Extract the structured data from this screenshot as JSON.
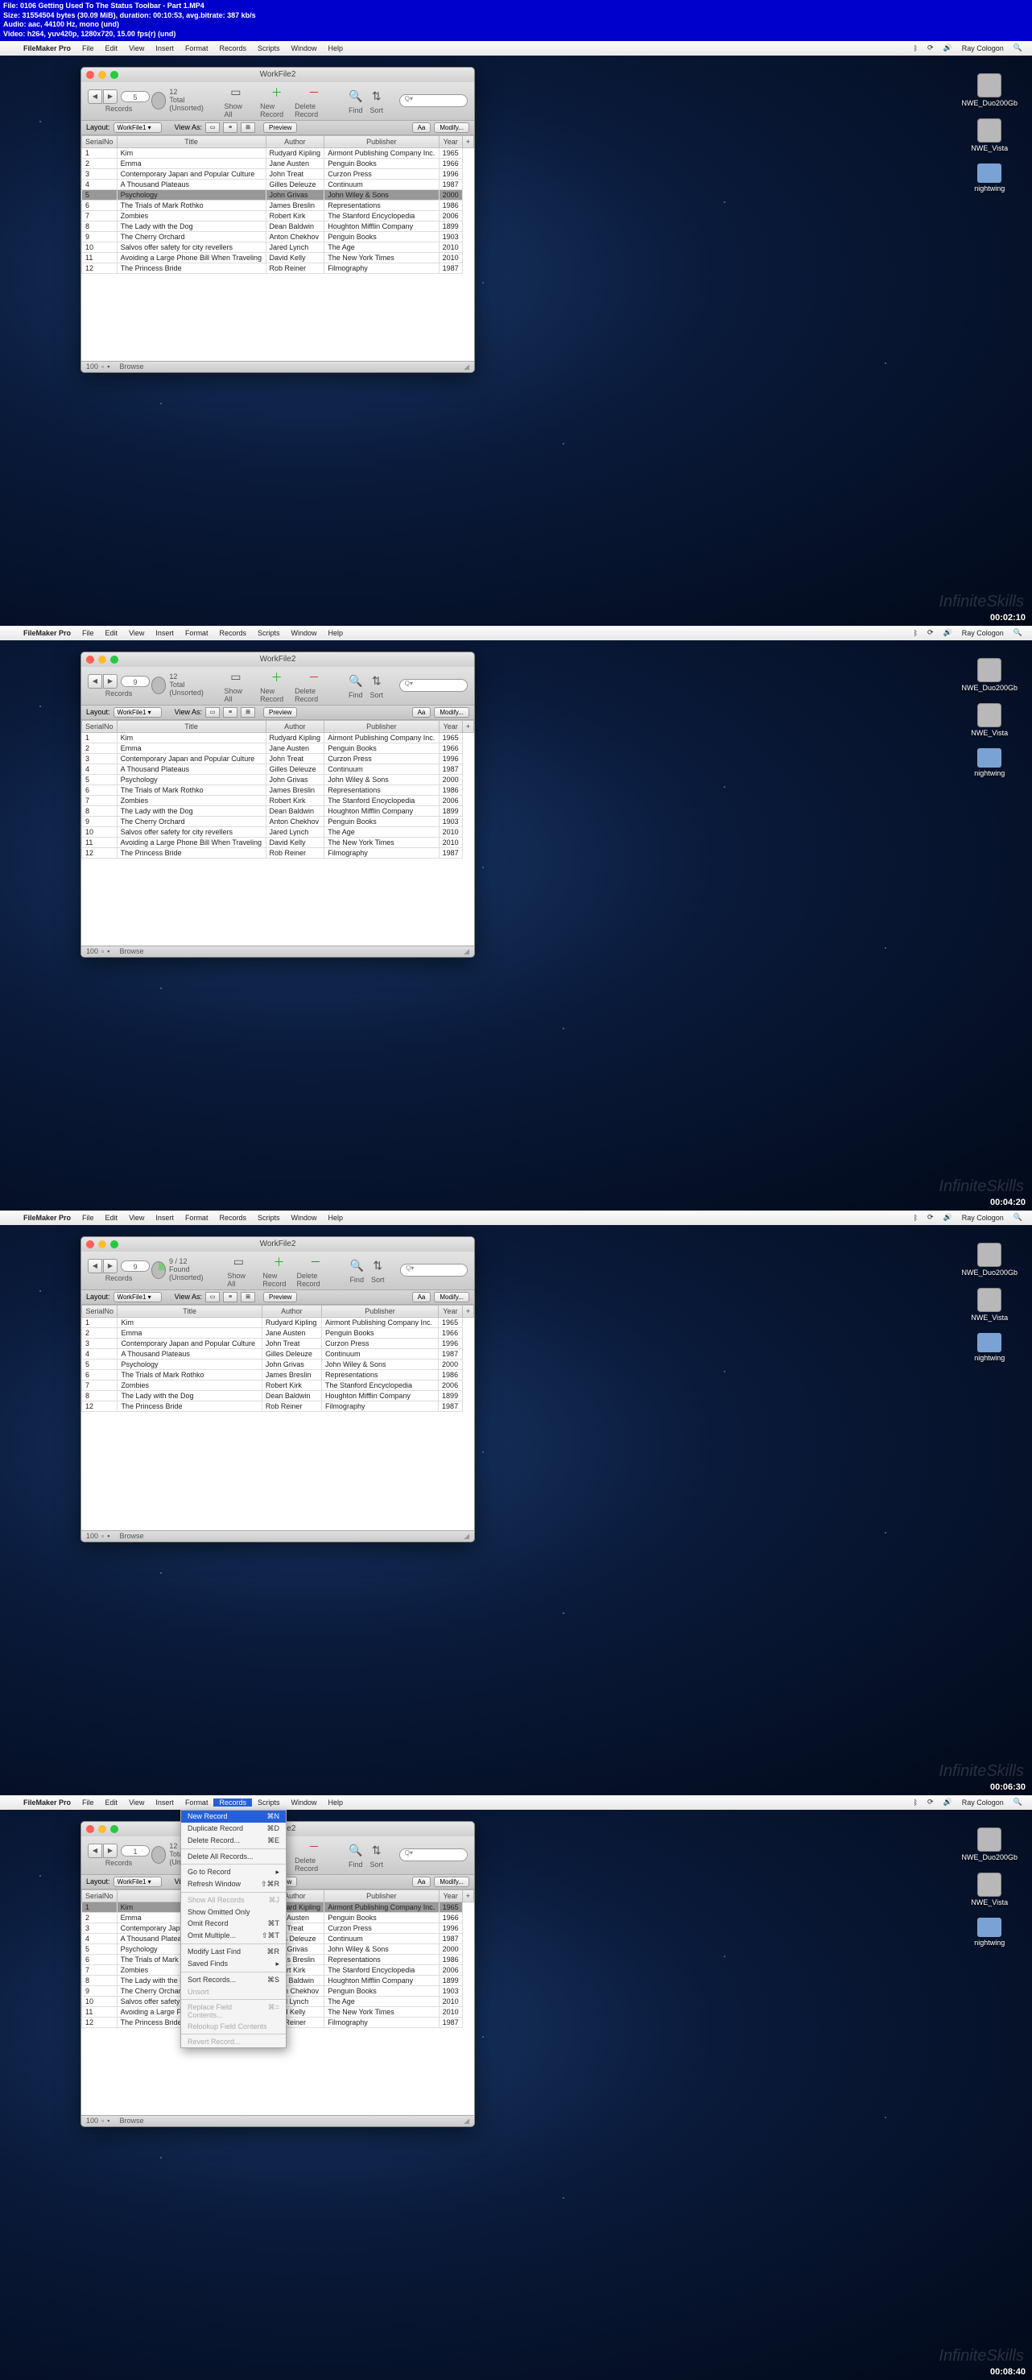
{
  "header_lines": [
    "File: 0106 Getting Used To The Status Toolbar - Part 1.MP4",
    "Size: 31554504 bytes (30.09 MiB), duration: 00:10:53, avg.bitrate: 387 kb/s",
    "Audio: aac, 44100 Hz, mono (und)",
    "Video: h264, yuv420p, 1280x720, 15.00 fps(r) (und)"
  ],
  "menu": {
    "apple": "",
    "app": "FileMaker Pro",
    "items": [
      "File",
      "Edit",
      "View",
      "Insert",
      "Format",
      "Records",
      "Scripts",
      "Window",
      "Help"
    ],
    "user": "Ray Cologon"
  },
  "win_title": "WorkFile2",
  "layout": {
    "label": "Layout:",
    "value": "WorkFile1",
    "view": "View As:",
    "preview": "Preview",
    "aa": "Aa",
    "modify": "Modify..."
  },
  "toolbar": {
    "records": "Records",
    "total_un": "Total (Unsorted)",
    "found_un": "Found (Unsorted)",
    "show_all": "Show All",
    "new_rec": "New Record",
    "del_rec": "Delete Record",
    "find": "Find",
    "sort": "Sort",
    "search": "Q▾"
  },
  "status": {
    "zoom": "100",
    "mode": "Browse"
  },
  "desktop": [
    "NWE_Duo200Gb",
    "NWE_Vista",
    "nightwing"
  ],
  "watermark": "InfiniteSkills",
  "cols": [
    "SerialNo",
    "Title",
    "Author",
    "Publisher",
    "Year"
  ],
  "frames": [
    {
      "timestamp": "00:02:10",
      "counter": "5",
      "total": "12",
      "rec_label": "12",
      "rows": [
        [
          "1",
          "Kim",
          "Rudyard Kipling",
          "Airmont Publishing Company Inc.",
          "1965"
        ],
        [
          "2",
          "Emma",
          "Jane Austen",
          "Penguin Books",
          "1966"
        ],
        [
          "3",
          "Contemporary Japan and Popular Culture",
          "John Treat",
          "Curzon Press",
          "1996"
        ],
        [
          "4",
          "A Thousand Plateaus",
          "Gilles Deleuze",
          "Continuum",
          "1987"
        ],
        [
          "5",
          "Psychology",
          "John Grivas",
          "John Wiley & Sons",
          "2000"
        ],
        [
          "6",
          "The Trials of Mark Rothko",
          "James Breslin",
          "Representations",
          "1986"
        ],
        [
          "7",
          "Zombies",
          "Robert Kirk",
          "The Stanford Encyclopedia",
          "2006"
        ],
        [
          "8",
          "The Lady with the Dog",
          "Dean Baldwin",
          "Houghton Mifflin Company",
          "1899"
        ],
        [
          "9",
          "The Cherry Orchard",
          "Anton Chekhov",
          "Penguin Books",
          "1903"
        ],
        [
          "10",
          "Salvos offer safety for city revellers",
          "Jared Lynch",
          "The Age",
          "2010"
        ],
        [
          "11",
          "Avoiding a Large Phone Bill When Traveling",
          "David Kelly",
          "The New York Times",
          "2010"
        ],
        [
          "12",
          "The Princess Bride",
          "Rob Reiner",
          "Filmography",
          "1987"
        ]
      ],
      "hl": 4
    },
    {
      "timestamp": "00:04:20",
      "counter": "9",
      "total": "12",
      "rec_label": "12",
      "rows": [
        [
          "1",
          "Kim",
          "Rudyard Kipling",
          "Airmont Publishing Company Inc.",
          "1965"
        ],
        [
          "2",
          "Emma",
          "Jane Austen",
          "Penguin Books",
          "1966"
        ],
        [
          "3",
          "Contemporary Japan and Popular Culture",
          "John Treat",
          "Curzon Press",
          "1996"
        ],
        [
          "4",
          "A Thousand Plateaus",
          "Gilles Deleuze",
          "Continuum",
          "1987"
        ],
        [
          "5",
          "Psychology",
          "John Grivas",
          "John Wiley & Sons",
          "2000"
        ],
        [
          "6",
          "The Trials of Mark Rothko",
          "James Breslin",
          "Representations",
          "1986"
        ],
        [
          "7",
          "Zombies",
          "Robert Kirk",
          "The Stanford Encyclopedia",
          "2006"
        ],
        [
          "8",
          "The Lady with the Dog",
          "Dean Baldwin",
          "Houghton Mifflin Company",
          "1899"
        ],
        [
          "9",
          "The Cherry Orchard",
          "Anton Chekhov",
          "Penguin Books",
          "1903"
        ],
        [
          "10",
          "Salvos offer safety for city revellers",
          "Jared Lynch",
          "The Age",
          "2010"
        ],
        [
          "11",
          "Avoiding a Large Phone Bill When Traveling",
          "David Kelly",
          "The New York Times",
          "2010"
        ],
        [
          "12",
          "The Princess Bride",
          "Rob Reiner",
          "Filmography",
          "1987"
        ]
      ],
      "hl": -1
    },
    {
      "timestamp": "00:06:30",
      "counter": "9",
      "total": "9 / 12",
      "rec_label": "9 / 12",
      "found": true,
      "rows": [
        [
          "1",
          "Kim",
          "Rudyard Kipling",
          "Airmont Publishing Company Inc.",
          "1965"
        ],
        [
          "2",
          "Emma",
          "Jane Austen",
          "Penguin Books",
          "1966"
        ],
        [
          "3",
          "Contemporary Japan and Popular Culture",
          "John Treat",
          "Curzon Press",
          "1996"
        ],
        [
          "4",
          "A Thousand Plateaus",
          "Gilles Deleuze",
          "Continuum",
          "1987"
        ],
        [
          "5",
          "Psychology",
          "John Grivas",
          "John Wiley & Sons",
          "2000"
        ],
        [
          "6",
          "The Trials of Mark Rothko",
          "James Breslin",
          "Representations",
          "1986"
        ],
        [
          "7",
          "Zombies",
          "Robert Kirk",
          "The Stanford Encyclopedia",
          "2006"
        ],
        [
          "8",
          "The Lady with the Dog",
          "Dean Baldwin",
          "Houghton Mifflin Company",
          "1899"
        ],
        [
          "12",
          "The Princess Bride",
          "Rob Reiner",
          "Filmography",
          "1987"
        ]
      ],
      "hl": -1
    },
    {
      "timestamp": "00:08:40",
      "counter": "1",
      "total": "12",
      "rec_label": "12",
      "menu_open": true,
      "rows": [
        [
          "1",
          "Kim",
          "Rudyard Kipling",
          "Airmont Publishing Company Inc.",
          "1965"
        ],
        [
          "2",
          "Emma",
          "Jane Austen",
          "Penguin Books",
          "1966"
        ],
        [
          "3",
          "Contemporary Japan and Popular Culture",
          "John Treat",
          "Curzon Press",
          "1996"
        ],
        [
          "4",
          "A Thousand Plateaus",
          "Gilles Deleuze",
          "Continuum",
          "1987"
        ],
        [
          "5",
          "Psychology",
          "John Grivas",
          "John Wiley & Sons",
          "2000"
        ],
        [
          "6",
          "The Trials of Mark Rothko",
          "James Breslin",
          "Representations",
          "1986"
        ],
        [
          "7",
          "Zombies",
          "Robert Kirk",
          "The Stanford Encyclopedia",
          "2006"
        ],
        [
          "8",
          "The Lady with the Dog",
          "Dean Baldwin",
          "Houghton Mifflin Company",
          "1899"
        ],
        [
          "9",
          "The Cherry Orchard",
          "Anton Chekhov",
          "Penguin Books",
          "1903"
        ],
        [
          "10",
          "Salvos offer safety for city revellers",
          "Jared Lynch",
          "The Age",
          "2010"
        ],
        [
          "11",
          "Avoiding a Large Phone Bill When Traveling",
          "David Kelly",
          "The New York Times",
          "2010"
        ],
        [
          "12",
          "The Princess Bride",
          "Rob Reiner",
          "Filmography",
          "1987"
        ]
      ],
      "hl": 0
    }
  ],
  "records_menu": [
    {
      "l": "New Record",
      "s": "⌘N",
      "hl": true
    },
    {
      "l": "Duplicate Record",
      "s": "⌘D"
    },
    {
      "l": "Delete Record...",
      "s": "⌘E"
    },
    {
      "sep": true
    },
    {
      "l": "Delete All Records..."
    },
    {
      "sep": true
    },
    {
      "l": "Go to Record",
      "s": "▸"
    },
    {
      "l": "Refresh Window",
      "s": "⇧⌘R"
    },
    {
      "sep": true
    },
    {
      "l": "Show All Records",
      "s": "⌘J",
      "dis": true
    },
    {
      "l": "Show Omitted Only"
    },
    {
      "l": "Omit Record",
      "s": "⌘T"
    },
    {
      "l": "Omit Multiple...",
      "s": "⇧⌘T"
    },
    {
      "sep": true
    },
    {
      "l": "Modify Last Find",
      "s": "⌘R"
    },
    {
      "l": "Saved Finds",
      "s": "▸"
    },
    {
      "sep": true
    },
    {
      "l": "Sort Records...",
      "s": "⌘S"
    },
    {
      "l": "Unsort",
      "dis": true
    },
    {
      "sep": true
    },
    {
      "l": "Replace Field Contents...",
      "s": "⌘=",
      "dis": true
    },
    {
      "l": "Relookup Field Contents",
      "dis": true
    },
    {
      "sep": true
    },
    {
      "l": "Revert Record...",
      "dis": true
    }
  ]
}
